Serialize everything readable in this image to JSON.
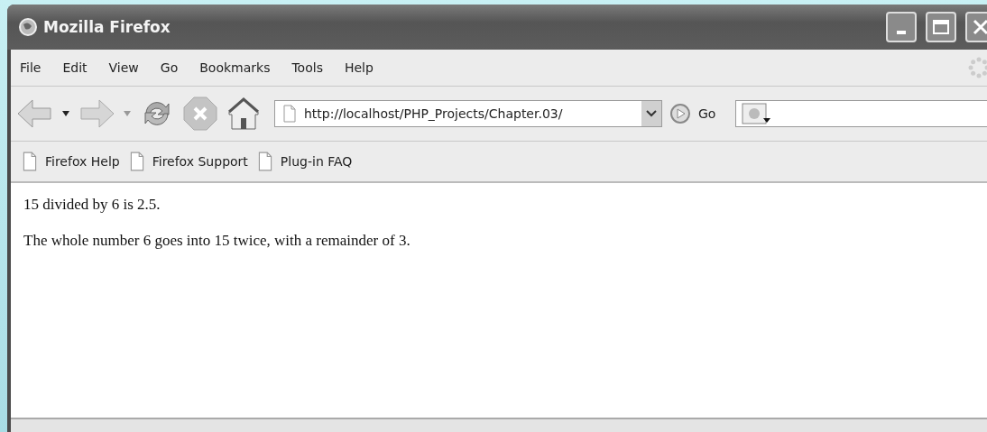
{
  "window": {
    "title": "Mozilla Firefox"
  },
  "menu": [
    {
      "label": "File"
    },
    {
      "label": "Edit"
    },
    {
      "label": "View"
    },
    {
      "label": "Go"
    },
    {
      "label": "Bookmarks"
    },
    {
      "label": "Tools"
    },
    {
      "label": "Help"
    }
  ],
  "toolbar": {
    "address": "http://localhost/PHP_Projects/Chapter.03/",
    "go": "Go"
  },
  "bookmarks": [
    {
      "label": "Firefox Help"
    },
    {
      "label": "Firefox Support"
    },
    {
      "label": "Plug-in FAQ"
    }
  ],
  "content": {
    "paragraphs": [
      "15 divided by 6 is 2.5.",
      "The whole number 6 goes into 15 twice, with a remainder of 3."
    ]
  }
}
